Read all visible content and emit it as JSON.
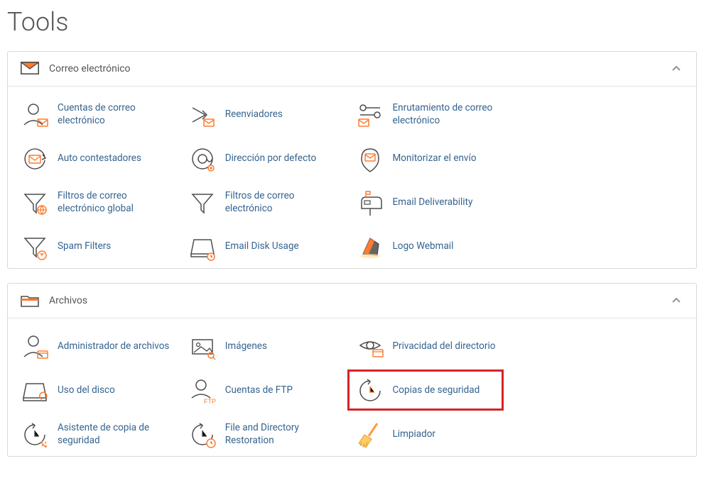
{
  "page_title": "Tools",
  "sections": {
    "email": {
      "title": "Correo electrónico",
      "items": {
        "accounts": "Cuentas de correo electrónico",
        "forwarders": "Reenviadores",
        "routing": "Enrutamiento de correo electrónico",
        "autoresponders": "Auto contestadores",
        "default_addr": "Dirección por defecto",
        "track_delivery": "Monitorizar el envío",
        "global_filters": "Filtros de correo electrónico global",
        "filters": "Filtros de correo electrónico",
        "deliverability": "Email Deliverability",
        "spam": "Spam Filters",
        "disk_usage": "Email Disk Usage",
        "webmail": "Logo Webmail"
      }
    },
    "files": {
      "title": "Archivos",
      "items": {
        "file_manager": "Administrador de archivos",
        "images": "Imágenes",
        "dir_privacy": "Privacidad del directorio",
        "disk_usage": "Uso del disco",
        "ftp_accounts": "Cuentas de FTP",
        "backup": "Copias de seguridad",
        "backup_wizard": "Asistente de copia de seguridad",
        "file_restore": "File and Directory Restoration",
        "cleaner": "Limpiador"
      }
    }
  }
}
